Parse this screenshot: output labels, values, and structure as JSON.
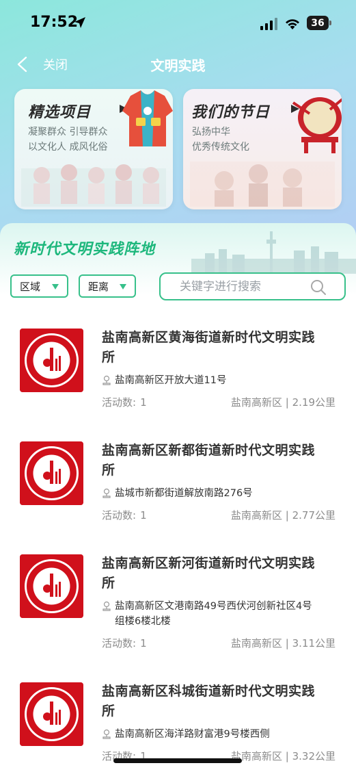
{
  "status_bar": {
    "time": "17:52",
    "battery": "36"
  },
  "nav": {
    "close_label": "关闭",
    "title": "文明实践"
  },
  "cards": [
    {
      "title": "精选项目",
      "line1": "凝聚群众 引导群众",
      "line2": "以文化人 成风化俗"
    },
    {
      "title": "我们的节日",
      "line1": "弘扬中华",
      "line2": "优秀传统文化"
    }
  ],
  "section": {
    "title": "新时代文明实践阵地"
  },
  "filters": {
    "region": "区域",
    "distance": "距离"
  },
  "search": {
    "placeholder": "关键字进行搜索"
  },
  "list": {
    "count_label": "活动数:",
    "items": [
      {
        "name_line1": "盐南高新区黄海街道新时代文明实践",
        "name_line2": "所",
        "address_line1": "盐南高新区开放大道11号",
        "address_line2": "",
        "count": "1",
        "location": "盐南高新区 | 2.19公里"
      },
      {
        "name_line1": "盐南高新区新都街道新时代文明实践",
        "name_line2": "所",
        "address_line1": "盐城市新都街道解放南路276号",
        "address_line2": "",
        "count": "1",
        "location": "盐南高新区 | 2.77公里"
      },
      {
        "name_line1": "盐南高新区新河街道新时代文明实践",
        "name_line2": "所",
        "address_line1": "盐南高新区文港南路49号西伏河创新社区4号",
        "address_line2": "组楼6楼北楼",
        "count": "1",
        "location": "盐南高新区 | 3.11公里"
      },
      {
        "name_line1": "盐南高新区科城街道新时代文明实践",
        "name_line2": "所",
        "address_line1": "盐南高新区海洋路财富港9号楼西侧",
        "address_line2": "",
        "count": "1",
        "location": "盐南高新区 | 3.32公里"
      }
    ]
  },
  "colors": {
    "accent": "#37c08a",
    "section_title": "#1db77c",
    "logo_red": "#d0101b"
  }
}
